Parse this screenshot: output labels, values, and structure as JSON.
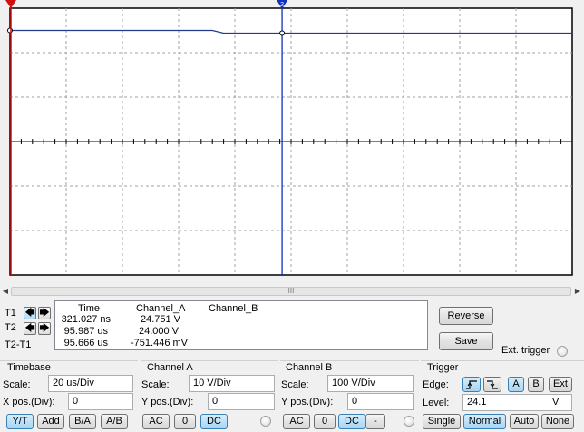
{
  "scope": {
    "background": "#ffffff",
    "grid_color": "#a0a0a0",
    "trace_a_color": "#1f3a8f",
    "cursor1_color": "#d01010",
    "cursor2_color": "#1030c0",
    "cursor1_label": "1",
    "cursor2_label": "2",
    "trace_a_level_div": 2.5
  },
  "scrollbar": {
    "left_icon": "scroll-left-icon",
    "right_icon": "scroll-right-icon",
    "grip": "III"
  },
  "cursors": {
    "t1_label": "T1",
    "t2_label": "T2",
    "diff_label": "T2-T1"
  },
  "readout": {
    "headers": [
      "Time",
      "Channel_A",
      "Channel_B"
    ],
    "rows": [
      {
        "time": "321.027 ns",
        "channel_a": "24.751 V",
        "channel_b": ""
      },
      {
        "time": "95.987 us",
        "channel_a": "24.000 V",
        "channel_b": ""
      },
      {
        "time": "95.666 us",
        "channel_a": "-751.446 mV",
        "channel_b": ""
      }
    ]
  },
  "buttons": {
    "reverse": "Reverse",
    "save": "Save",
    "ext_trigger": "Ext. trigger"
  },
  "timebase": {
    "title": "Timebase",
    "scale_label": "Scale:",
    "scale_value": "20 us/Div",
    "xpos_label": "X pos.(Div):",
    "xpos_value": "0",
    "modes": [
      "Y/T",
      "Add",
      "B/A",
      "A/B"
    ],
    "active_mode": "Y/T"
  },
  "channel_a": {
    "title": "Channel A",
    "scale_label": "Scale:",
    "scale_value": "10  V/Div",
    "ypos_label": "Y pos.(Div):",
    "ypos_value": "0",
    "coupling": [
      "AC",
      "0",
      "DC"
    ],
    "active_coupling": "DC"
  },
  "channel_b": {
    "title": "Channel B",
    "scale_label": "Scale:",
    "scale_value": "100  V/Div",
    "ypos_label": "Y pos.(Div):",
    "ypos_value": "0",
    "coupling": [
      "AC",
      "0",
      "DC",
      "-"
    ],
    "active_coupling": "DC"
  },
  "trigger": {
    "title": "Trigger",
    "edge_label": "Edge:",
    "edge_rising_icon": "rising-edge-icon",
    "edge_falling_icon": "falling-edge-icon",
    "sources": [
      "A",
      "B",
      "Ext"
    ],
    "active_source": "A",
    "level_label": "Level:",
    "level_value": "24.1",
    "level_unit": "V",
    "modes": [
      "Single",
      "Normal",
      "Auto",
      "None"
    ],
    "active_mode": "Normal"
  }
}
